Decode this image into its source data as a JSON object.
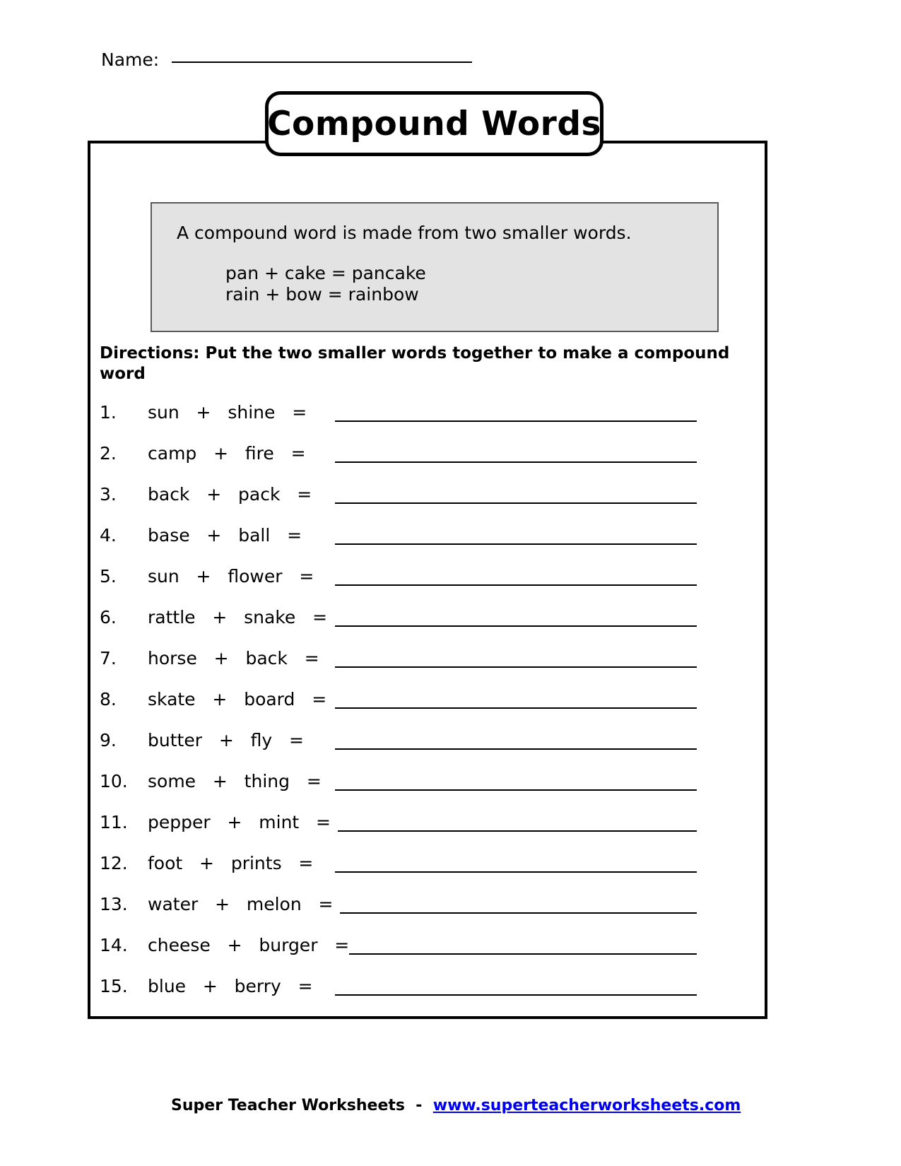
{
  "name_field": {
    "label": "Name:",
    "value": ""
  },
  "title": "Compound Words",
  "definition_box": {
    "sentence": "A compound word is made from two smaller words.",
    "examples": [
      "pan + cake = pancake",
      "rain + bow = rainbow"
    ]
  },
  "directions": "Directions:  Put the two smaller words together to make a compound word",
  "problems": [
    {
      "number": "1.",
      "expression": "sun   +   shine   =",
      "answer": ""
    },
    {
      "number": "2.",
      "expression": "camp   +   fire   =",
      "answer": ""
    },
    {
      "number": "3.",
      "expression": "back   +   pack   =",
      "answer": ""
    },
    {
      "number": "4.",
      "expression": "base   +   ball   =",
      "answer": ""
    },
    {
      "number": "5.",
      "expression": "sun   +   flower   =",
      "answer": ""
    },
    {
      "number": "6.",
      "expression": "rattle   +   snake   =",
      "answer": ""
    },
    {
      "number": "7.",
      "expression": "horse   +   back   =",
      "answer": ""
    },
    {
      "number": "8.",
      "expression": "skate   +   board   =",
      "answer": ""
    },
    {
      "number": "9.",
      "expression": "butter   +   fly   =",
      "answer": ""
    },
    {
      "number": "10.",
      "expression": "some   +   thing   =",
      "answer": ""
    },
    {
      "number": "11.",
      "expression": "pepper   +   mint   =",
      "answer": ""
    },
    {
      "number": "12.",
      "expression": "foot   +   prints   =",
      "answer": ""
    },
    {
      "number": "13.",
      "expression": "water   +   melon   =",
      "answer": ""
    },
    {
      "number": "14.",
      "expression": "cheese   +   burger   =",
      "answer": ""
    },
    {
      "number": "15.",
      "expression": "blue   +   berry   =",
      "answer": ""
    }
  ],
  "footer": {
    "brand": "Super Teacher Worksheets",
    "separator": "  -  ",
    "url": "www.superteacherworksheets.com",
    "url_color": "#0000ee"
  },
  "colors": {
    "definition_box_fill": "#e3e3e3",
    "definition_box_border": "#5a5a5a",
    "ink": "#000000",
    "page": "#ffffff"
  }
}
